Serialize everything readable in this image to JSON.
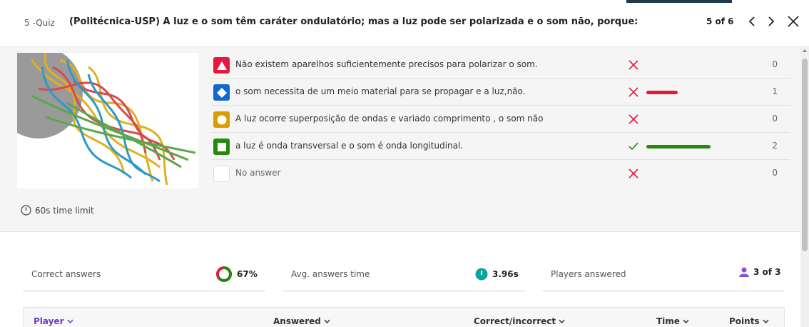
{
  "header": {
    "quiz_number": "5 -Quiz",
    "question": "(Politécnica-USP) A luz e o som têm caráter ondulatório; mas a luz pode ser polarizada e o som não, porque:",
    "pager": "5 of 6"
  },
  "question_panel": {
    "time_limit": "60s time limit",
    "answers": [
      {
        "text": "Não existem aparelhos suficientemente precisos para polarizar o som.",
        "shape": "triangle",
        "color": "#e21b3c",
        "correct": false,
        "count": "0",
        "fraction": 0
      },
      {
        "text": "o som necessita de um meio material para se propagar e a luz,não.",
        "shape": "diamond",
        "color": "#1368ce",
        "correct": false,
        "count": "1",
        "fraction": 0.33
      },
      {
        "text": "A luz ocorre superposição de ondas e variado comprimento , o som não",
        "shape": "circle",
        "color": "#d89e00",
        "correct": false,
        "count": "0",
        "fraction": 0
      },
      {
        "text": "a luz é onda transversal e o som é onda longitudinal.",
        "shape": "square",
        "color": "#26890c",
        "correct": true,
        "count": "2",
        "fraction": 0.67
      },
      {
        "text": "No answer",
        "shape": "none",
        "color": "#ffffff",
        "correct": false,
        "count": "0",
        "fraction": 0
      }
    ]
  },
  "stats": {
    "correct_label": "Correct answers",
    "correct_value": "67%",
    "correct_fraction": 0.67,
    "time_label": "Avg. answers time",
    "time_value": "3.96s",
    "players_label": "Players answered",
    "players_value": "3 of 3"
  },
  "table": {
    "columns": [
      "Player",
      "Answered",
      "Correct/incorrect",
      "Time",
      "Points"
    ]
  },
  "colors": {
    "incorrect": "#e21b3c",
    "correct": "#26890c",
    "accent": "#6a3cc4",
    "time_badge": "#0aa3a3"
  }
}
